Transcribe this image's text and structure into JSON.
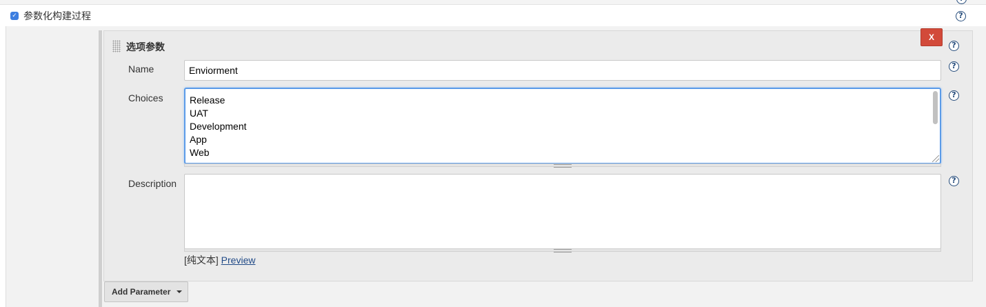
{
  "parameterized_build": {
    "checked": true,
    "label": "参数化构建过程"
  },
  "choice_parameter": {
    "title": "选项参数",
    "close_label": "X",
    "name_label": "Name",
    "name_value": "Enviorment",
    "choices_label": "Choices",
    "choices": [
      "Release",
      "UAT",
      "Development",
      "App",
      "Web"
    ],
    "description_label": "Description",
    "description_value": "",
    "format_prefix": "[纯文本]",
    "preview_label": "Preview"
  },
  "add_parameter": {
    "label": "Add Parameter"
  },
  "icons": {
    "help": "?",
    "check": "✓"
  },
  "colors": {
    "close_button": "#d24a3a",
    "focus_border": "#5b9be8",
    "link": "#204a87",
    "checkbox": "#3d7ee0"
  }
}
